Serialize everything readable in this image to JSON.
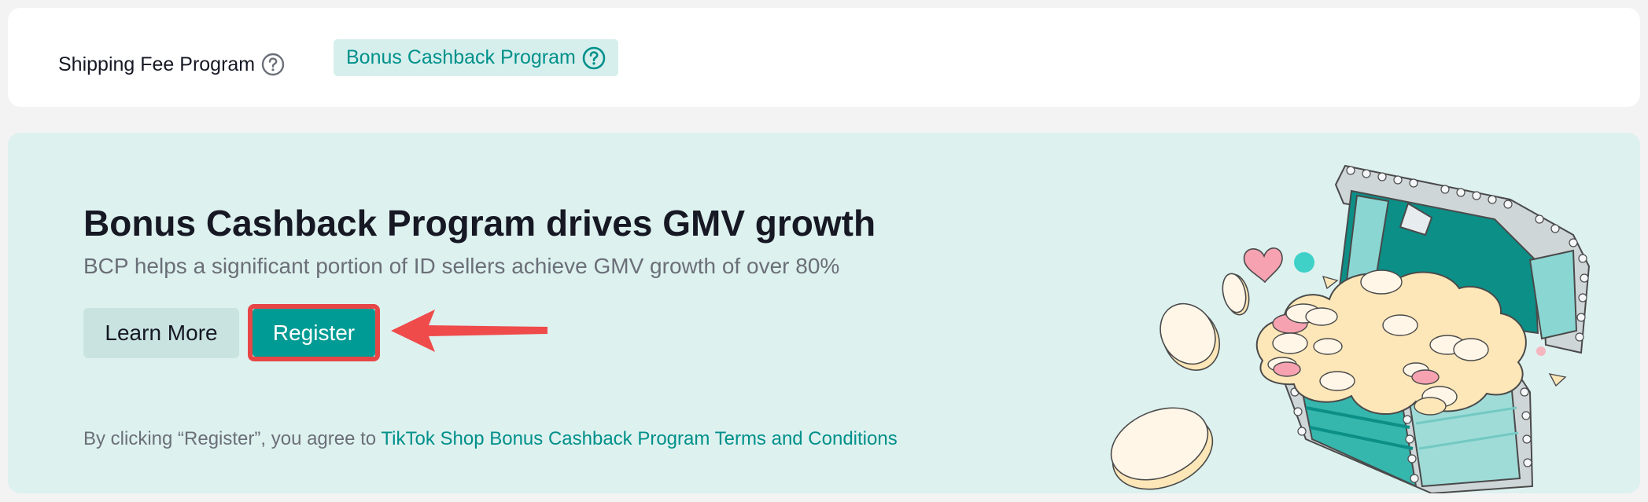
{
  "tabs": {
    "shipping_fee": "Shipping Fee Program",
    "bonus_cashback": "Bonus Cashback Program"
  },
  "hero": {
    "title": "Bonus Cashback Program drives GMV growth",
    "subtitle": "BCP helps a significant portion of ID sellers achieve GMV growth of over 80%",
    "learn_more_label": "Learn More",
    "register_label": "Register",
    "terms_prefix": "By clicking “Register”, you agree to ",
    "terms_link": "TikTok Shop Bonus Cashback Program Terms and Conditions"
  },
  "icons": {
    "help": "question-circle-icon",
    "annotation": "red-arrow-icon",
    "illustration": "treasure-chest-with-coins"
  },
  "colors": {
    "accent": "#009b94",
    "accent_text": "#00908a",
    "hero_background": "#ddf1ef",
    "highlight": "#e74646"
  }
}
